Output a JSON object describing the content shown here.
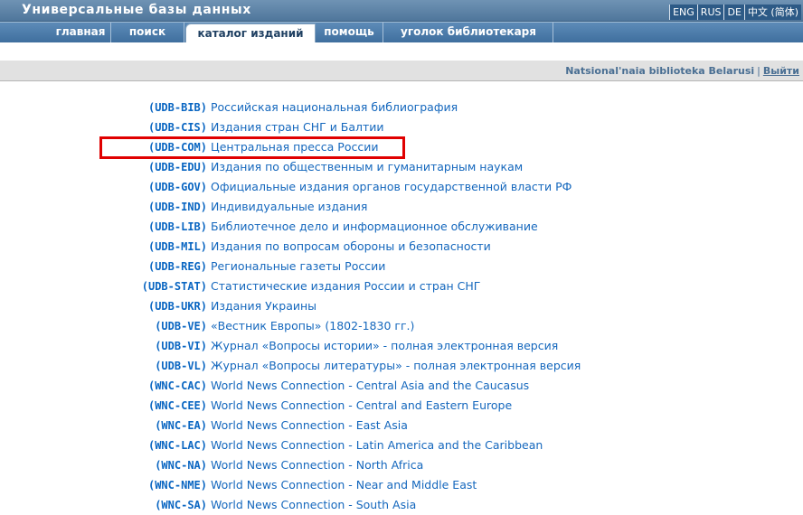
{
  "header": {
    "title": "Универсальные базы данных",
    "languages": [
      "ENG",
      "RUS",
      "DE",
      "中文 (简体)"
    ]
  },
  "nav": {
    "tabs": [
      {
        "label": "главная",
        "active": false
      },
      {
        "label": "поиск",
        "active": false
      },
      {
        "label": "каталог изданий",
        "active": true
      },
      {
        "label": "помощь",
        "active": false
      },
      {
        "label": "уголок библиотекаря",
        "active": false
      }
    ]
  },
  "org": {
    "name": "Natsional'naia biblioteka Belarusi",
    "separator": "|",
    "exit_label": "Выйти"
  },
  "databases": [
    {
      "code": "(UDB-BIB)",
      "name": "Российская национальная библиография"
    },
    {
      "code": "(UDB-CIS)",
      "name": "Издания стран СНГ и Балтии"
    },
    {
      "code": "(UDB-COM)",
      "name": "Центральная пресса России"
    },
    {
      "code": "(UDB-EDU)",
      "name": "Издания по общественным и гуманитарным наукам"
    },
    {
      "code": "(UDB-GOV)",
      "name": "Официальные издания органов государственной власти РФ"
    },
    {
      "code": "(UDB-IND)",
      "name": "Индивидуальные издания"
    },
    {
      "code": "(UDB-LIB)",
      "name": "Библиотечное дело и информационное обслуживание"
    },
    {
      "code": "(UDB-MIL)",
      "name": "Издания по вопросам обороны и безопасности"
    },
    {
      "code": "(UDB-REG)",
      "name": "Региональные газеты России"
    },
    {
      "code": "(UDB-STAT)",
      "name": "Статистические издания России и стран СНГ"
    },
    {
      "code": "(UDB-UKR)",
      "name": "Издания Украины"
    },
    {
      "code": "(UDB-VE)",
      "name": "«Вестник Европы» (1802-1830 гг.)"
    },
    {
      "code": "(UDB-VI)",
      "name": "Журнал «Вопросы истории» - полная электронная версия"
    },
    {
      "code": "(UDB-VL)",
      "name": "Журнал «Вопросы литературы» - полная электронная версия"
    },
    {
      "code": "(WNC-CAC)",
      "name": "World News Connection - Central Asia and the Caucasus"
    },
    {
      "code": "(WNC-CEE)",
      "name": "World News Connection - Central and Eastern Europe"
    },
    {
      "code": "(WNC-EA)",
      "name": "World News Connection - East Asia"
    },
    {
      "code": "(WNC-LAC)",
      "name": "World News Connection - Latin America and the Caribbean"
    },
    {
      "code": "(WNC-NA)",
      "name": "World News Connection - North Africa"
    },
    {
      "code": "(WNC-NME)",
      "name": "World News Connection - Near and Middle East"
    },
    {
      "code": "(WNC-SA)",
      "name": "World News Connection - South Asia"
    }
  ],
  "colors": {
    "highlight": "#e00000",
    "link": "#1467bd",
    "code": "#0a66c2",
    "nav": "#4f769b"
  }
}
